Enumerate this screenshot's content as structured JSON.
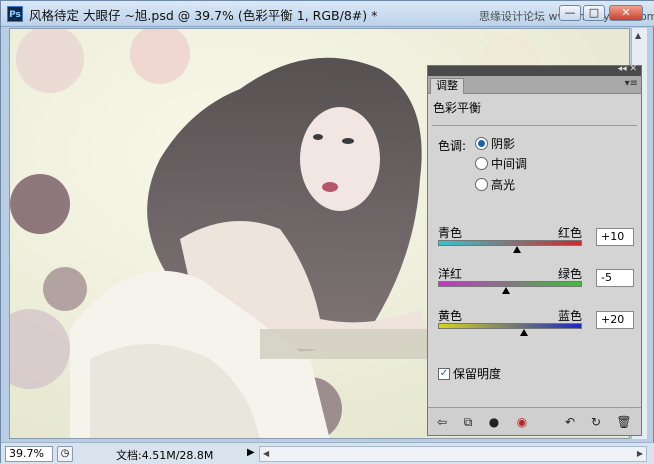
{
  "window": {
    "app_icon": "Ps",
    "title": "风格待定 大眼仔 ~旭.psd @ 39.7% (色彩平衡 1, RGB/8#) *",
    "watermark": "思缘设计论坛 www.missyuan.com",
    "min_label": "—",
    "max_label": "□",
    "close_label": "✕"
  },
  "status": {
    "zoom": "39.7%",
    "doc_info": "文档:4.51M/28.8M",
    "arrow": "▶"
  },
  "panel": {
    "tab": "调整",
    "heading": "色彩平衡",
    "tone_label": "色调:",
    "tones": [
      {
        "label": "阴影",
        "selected": true
      },
      {
        "label": "中间调",
        "selected": false
      },
      {
        "label": "高光",
        "selected": false
      }
    ],
    "sliders": [
      {
        "left": "青色",
        "right": "红色",
        "value": "+10",
        "fraction": 0.55,
        "gradient": [
          "#31c6cf",
          "#d4262a"
        ]
      },
      {
        "left": "洋红",
        "right": "绿色",
        "value": "-5",
        "fraction": 0.475,
        "gradient": [
          "#c236c6",
          "#3fbf3a"
        ]
      },
      {
        "left": "黄色",
        "right": "蓝色",
        "value": "+20",
        "fraction": 0.6,
        "gradient": [
          "#d8d418",
          "#1c27c7"
        ]
      }
    ],
    "preserve_luminosity": "保留明度",
    "preserve_checked": true
  },
  "icons": {
    "footer": [
      "back-arrow-icon",
      "expand-view-icon",
      "clip-layer-icon",
      "visibility-eye-icon",
      "previous-state-icon",
      "reset-icon",
      "trash-icon"
    ]
  }
}
